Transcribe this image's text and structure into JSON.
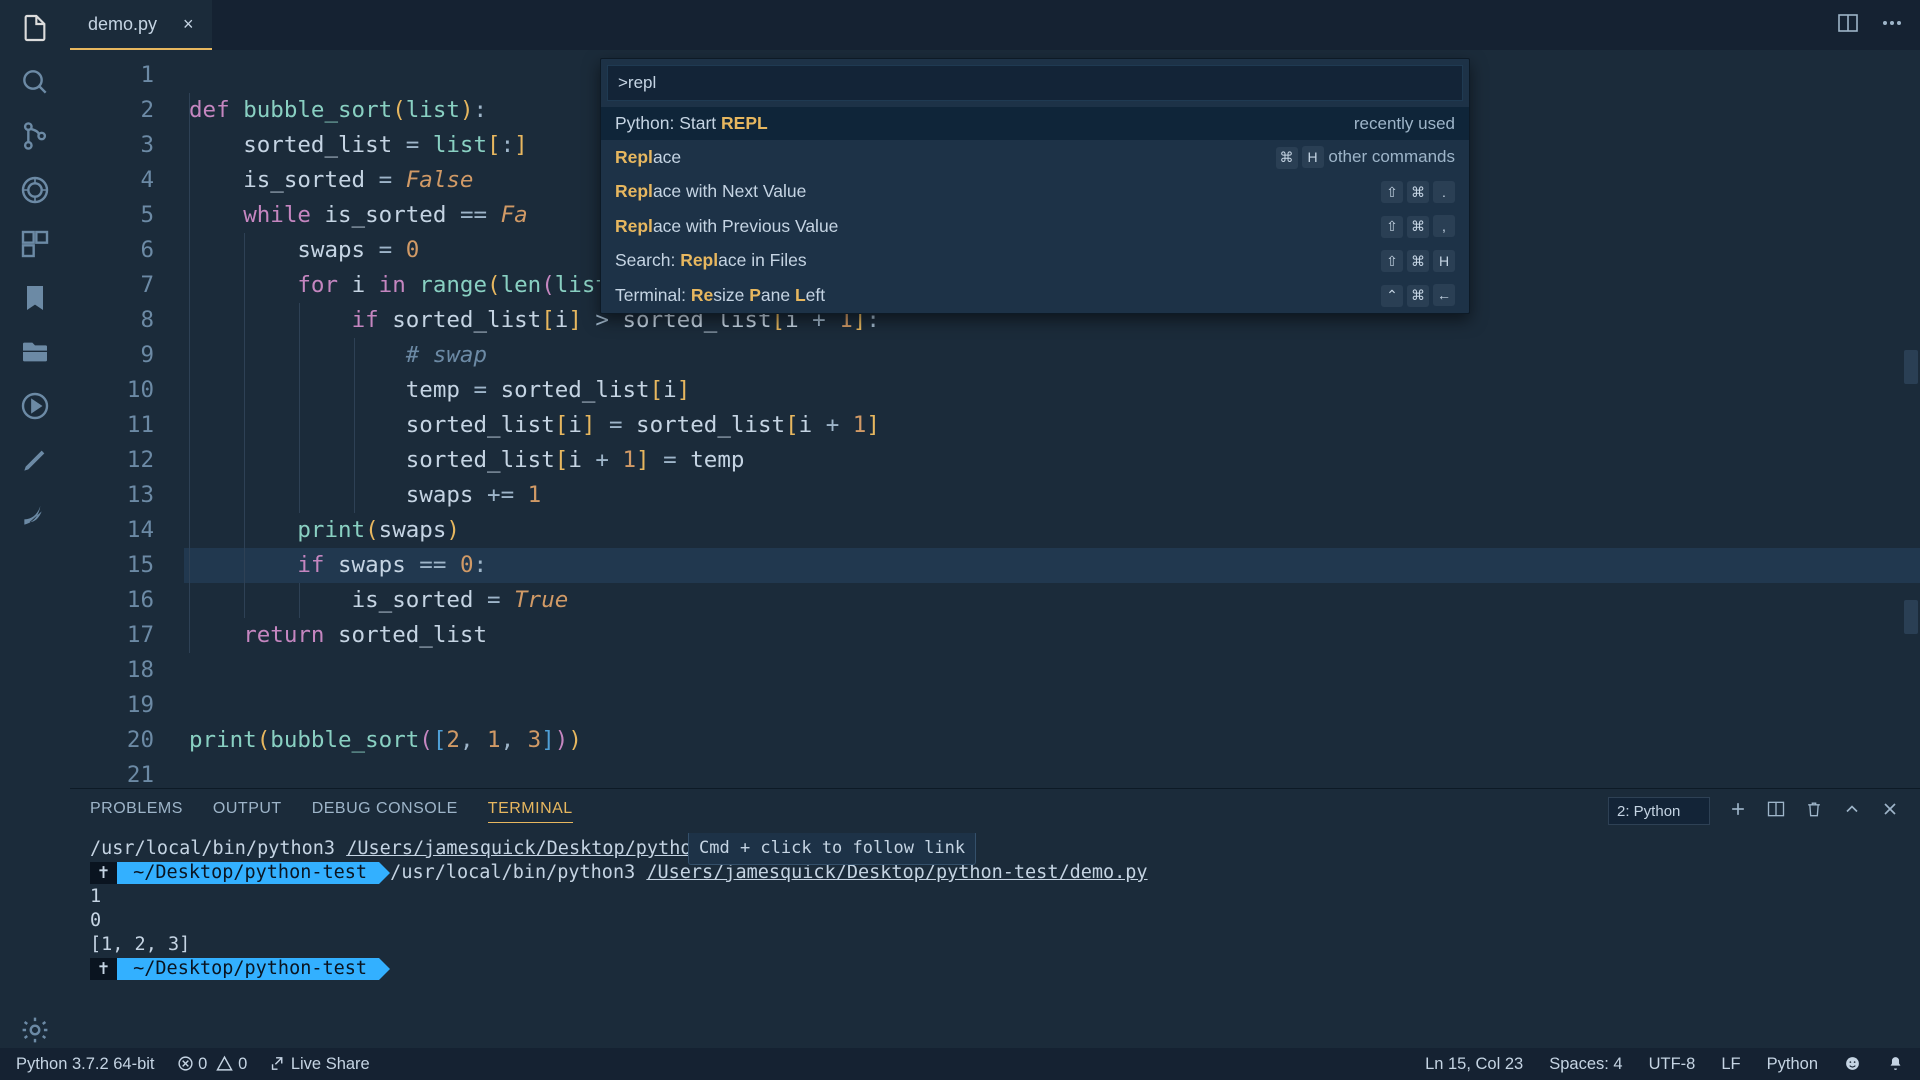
{
  "tab": {
    "title": "demo.py"
  },
  "palette": {
    "query": ">repl",
    "items": [
      {
        "prefix": "Python: Start ",
        "match": "REPL",
        "suffix": "",
        "hint_text": "recently used",
        "keys": []
      },
      {
        "prefix": "",
        "match": "Repl",
        "suffix": "ace",
        "hint_text": "other commands",
        "keys": [
          "⌘",
          "H"
        ]
      },
      {
        "prefix": "",
        "match": "Repl",
        "suffix": "ace with Next Value",
        "hint_text": "",
        "keys": [
          "⇧",
          "⌘",
          "."
        ]
      },
      {
        "prefix": "",
        "match": "Repl",
        "suffix": "ace with Previous Value",
        "hint_text": "",
        "keys": [
          "⇧",
          "⌘",
          ","
        ]
      },
      {
        "prefix": "Search: ",
        "match": "Repl",
        "suffix": "ace in Files",
        "hint_text": "",
        "keys": [
          "⇧",
          "⌘",
          "H"
        ]
      },
      {
        "prefix": "Terminal: ",
        "match": "Re",
        "suffix_parts": [
          [
            "size ",
            false
          ],
          [
            "P",
            true
          ],
          [
            "ane ",
            false
          ],
          [
            "L",
            true
          ],
          [
            "eft",
            false
          ]
        ],
        "hint_text": "",
        "keys": [
          "⌃",
          "⌘",
          "←"
        ]
      }
    ]
  },
  "tooltip": {
    "text": "Cmd + click to follow link"
  },
  "panel": {
    "tabs": [
      "PROBLEMS",
      "OUTPUT",
      "DEBUG CONSOLE",
      "TERMINAL"
    ],
    "active_tab": 3,
    "selector": "2: Python",
    "lines": {
      "l1a": "/usr/local/bin/python3 ",
      "l1b": "/Users/jamesquick/Desktop/python-test/demo.py",
      "l2a": "~/Desktop/python-test",
      "l2b": " /usr/local/bin/python3 ",
      "l2c": "/Users/jamesquick/Desktop/python-test/demo.py",
      "l3": "1",
      "l4": "0",
      "l5": "[1, 2, 3]",
      "l6": "~/Desktop/python-test"
    }
  },
  "status": {
    "python_env": "Python 3.7.2 64-bit",
    "errors": "0",
    "warnings": "0",
    "live_share": "Live Share",
    "cursor": "Ln 15, Col 23",
    "spaces": "Spaces: 4",
    "encoding": "UTF-8",
    "eol": "LF",
    "lang": "Python"
  },
  "code": {
    "line_count": 21
  }
}
